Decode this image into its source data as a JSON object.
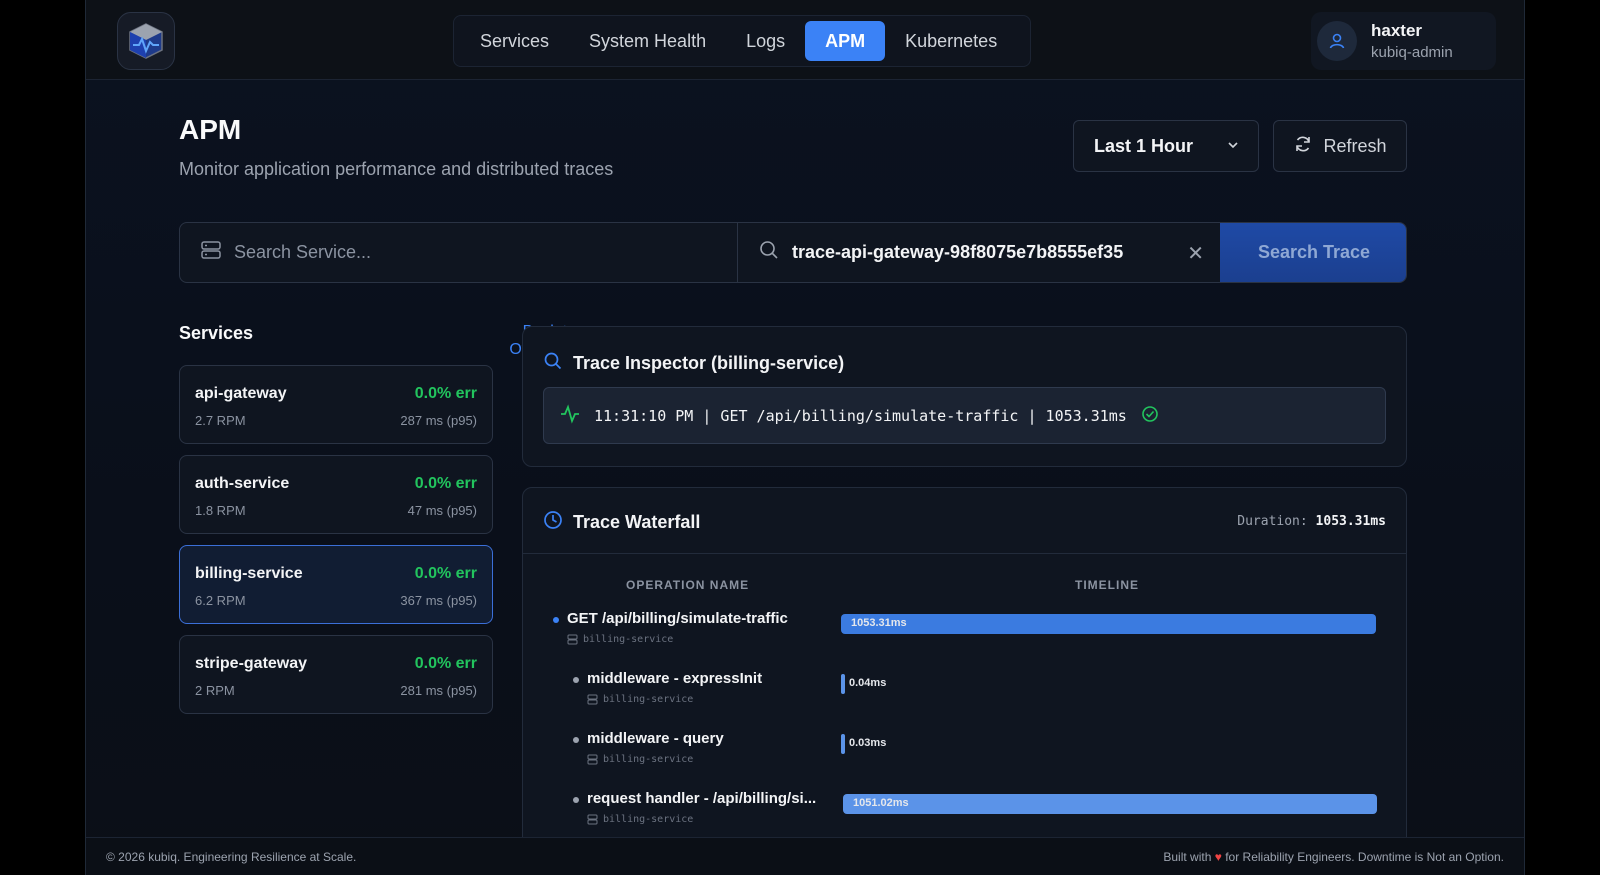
{
  "nav": {
    "items": [
      {
        "label": "Services"
      },
      {
        "label": "System Health"
      },
      {
        "label": "Logs"
      },
      {
        "label": "APM"
      },
      {
        "label": "Kubernetes"
      }
    ]
  },
  "user": {
    "name": "haxter",
    "role": "kubiq-admin"
  },
  "page": {
    "title": "APM",
    "subtitle": "Monitor application performance and distributed traces",
    "time_range": "Last 1 Hour",
    "refresh_label": "Refresh"
  },
  "search": {
    "service_placeholder": "Search Service...",
    "trace_value": "trace-api-gateway-98f8075e7b8555ef35",
    "button_label": "Search Trace"
  },
  "services": {
    "heading": "Services",
    "back_label": "Back to Overview",
    "items": [
      {
        "name": "api-gateway",
        "err": "0.0% err",
        "rpm": "2.7 RPM",
        "latency": "287 ms (p95)"
      },
      {
        "name": "auth-service",
        "err": "0.0% err",
        "rpm": "1.8 RPM",
        "latency": "47 ms (p95)"
      },
      {
        "name": "billing-service",
        "err": "0.0% err",
        "rpm": "6.2 RPM",
        "latency": "367 ms (p95)"
      },
      {
        "name": "stripe-gateway",
        "err": "0.0% err",
        "rpm": "2 RPM",
        "latency": "281 ms (p95)"
      }
    ]
  },
  "inspector": {
    "title": "Trace Inspector (billing-service)",
    "trace_line": "11:31:10 PM | GET /api/billing/simulate-traffic | 1053.31ms"
  },
  "waterfall": {
    "title": "Trace Waterfall",
    "duration_label": "Duration:",
    "duration_value": "1053.31ms",
    "col_operation": "OPERATION NAME",
    "col_timeline": "TIMELINE",
    "spans": [
      {
        "name": "GET /api/billing/simulate-traffic",
        "service": "billing-service",
        "duration": "1053.31ms",
        "fraction": 1.0
      },
      {
        "name": "middleware - expressInit",
        "service": "billing-service",
        "duration": "0.04ms",
        "fraction": 0.0
      },
      {
        "name": "middleware - query",
        "service": "billing-service",
        "duration": "0.03ms",
        "fraction": 0.0
      },
      {
        "name": "request handler - /api/billing/si...",
        "service": "billing-service",
        "duration": "1051.02ms",
        "fraction": 0.998
      }
    ]
  },
  "footer": {
    "left": "© 2026 kubiq. Engineering Resilience at Scale.",
    "built_with": "Built with",
    "right": "for Reliability Engineers. Downtime is Not an Option."
  },
  "colors": {
    "accent": "#3b82f6",
    "success": "#22c55e",
    "bar_root": "#3b7be0",
    "bar_child": "#5b93e8"
  }
}
